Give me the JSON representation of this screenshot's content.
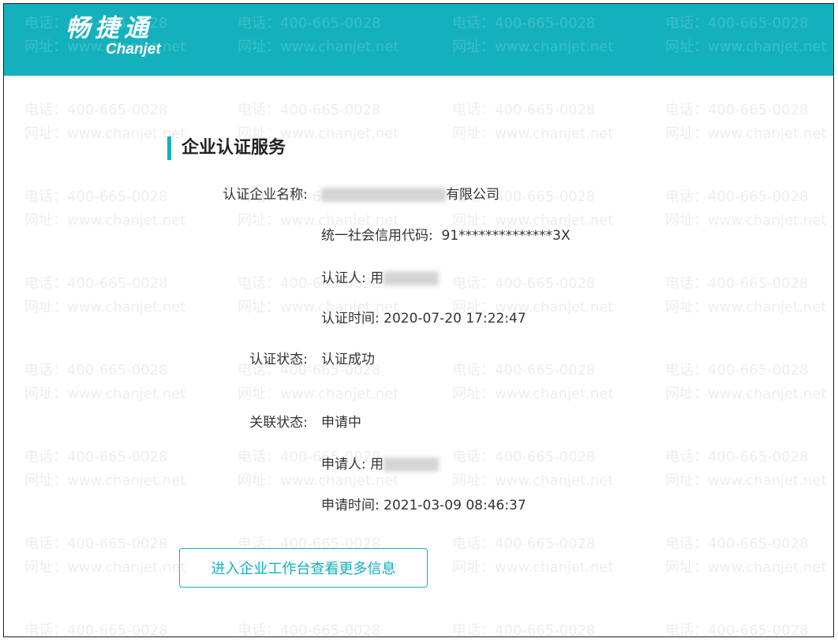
{
  "brand": {
    "name_cn": "畅捷通",
    "name_en": "Chanjet",
    "color": "#14b1bd"
  },
  "watermark": {
    "line1": "电话：400-665-0028",
    "line2": "网址：www.chanjet.net"
  },
  "section": {
    "title": "企业认证服务"
  },
  "fields": {
    "company_name_label": "认证企业名称:",
    "company_name_suffix": "有限公司",
    "credit_code_label": "统一社会信用代码:",
    "credit_code_value": "91**************3X",
    "certifier_label": "认证人:",
    "certifier_value": "用",
    "cert_time_label": "认证时间:",
    "cert_time_value": "2020-07-20 17:22:47",
    "cert_status_label": "认证状态:",
    "cert_status_value": "认证成功",
    "link_status_label": "关联状态:",
    "link_status_value": "申请中",
    "applicant_label": "申请人:",
    "applicant_value": "用",
    "apply_time_label": "申请时间:",
    "apply_time_value": "2021-03-09 08:46:37"
  },
  "actions": {
    "enter_workspace": "进入企业工作台查看更多信息"
  }
}
